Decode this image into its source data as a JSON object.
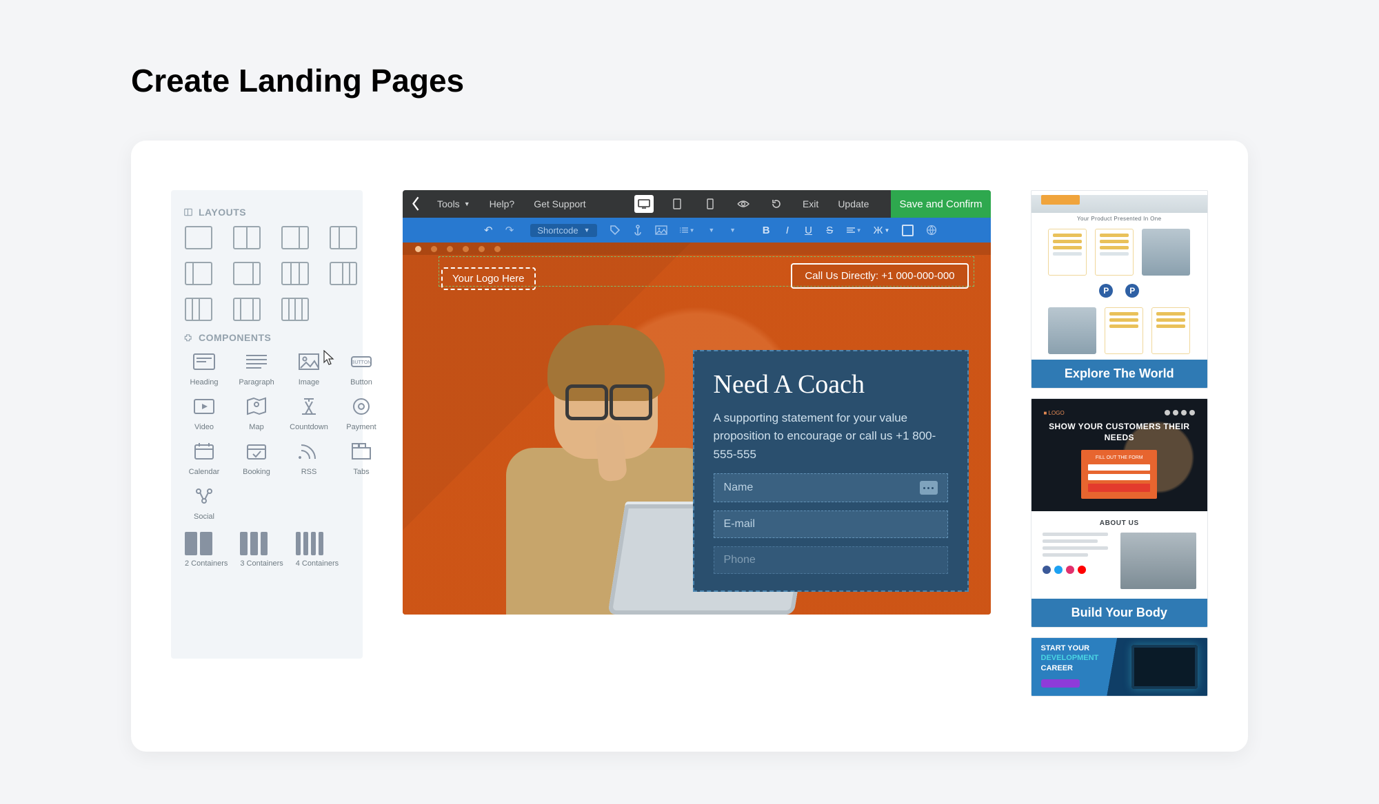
{
  "page_title": "Create Landing Pages",
  "panel": {
    "section_layouts": "LAYOUTS",
    "section_components": "COMPONENTS",
    "layouts": [
      {
        "cols": [
          1
        ]
      },
      {
        "cols": [
          1,
          1
        ]
      },
      {
        "cols": [
          2,
          1
        ]
      },
      {
        "cols": [
          1,
          2
        ]
      },
      {
        "cols": [
          1,
          3
        ]
      },
      {
        "cols": [
          3,
          1
        ]
      },
      {
        "cols": [
          1,
          1,
          1
        ]
      },
      {
        "cols": [
          2,
          1,
          1
        ]
      },
      {
        "cols": [
          1,
          1,
          2
        ]
      },
      {
        "cols": [
          1,
          2,
          1
        ]
      },
      {
        "cols": [
          1,
          1,
          1,
          1
        ]
      }
    ],
    "components": [
      {
        "name": "Heading"
      },
      {
        "name": "Paragraph"
      },
      {
        "name": "Image"
      },
      {
        "name": "Button"
      },
      {
        "name": "Video"
      },
      {
        "name": "Map"
      },
      {
        "name": "Countdown"
      },
      {
        "name": "Payment"
      },
      {
        "name": "Calendar"
      },
      {
        "name": "Booking"
      },
      {
        "name": "RSS"
      },
      {
        "name": "Tabs"
      },
      {
        "name": "Social"
      }
    ],
    "containers": [
      {
        "label": "2 Containers",
        "n": 2
      },
      {
        "label": "3 Containers",
        "n": 3
      },
      {
        "label": "4 Containers",
        "n": 4
      }
    ]
  },
  "editor": {
    "menu": {
      "tools": "Tools",
      "help": "Help?",
      "support": "Get Support",
      "exit": "Exit",
      "update": "Update",
      "save": "Save and Confirm"
    },
    "toolbar": {
      "shortcode": "Shortcode"
    },
    "canvas": {
      "logo_placeholder": "Your Logo Here",
      "call_cta": "Call Us Directly: +1 000-000-000",
      "hero_title": "Need A Coach",
      "hero_text": "A supporting statement for your value proposition to encourage or call us +1 800-555-555",
      "fields": {
        "name": "Name",
        "email": "E-mail",
        "phone": "Phone"
      }
    }
  },
  "templates": {
    "t1": {
      "tagline": "Your Product Presented In One",
      "footer": "Explore The World"
    },
    "t2": {
      "top_heading": "SHOW YOUR CUSTOMERS THEIR NEEDS",
      "form_title": "FILL OUT THE FORM",
      "about": "ABOUT US",
      "footer": "Build Your Body"
    },
    "t3": {
      "line1": "START YOUR",
      "line2": "DEVELOPMENT",
      "line3": "CAREER"
    }
  }
}
